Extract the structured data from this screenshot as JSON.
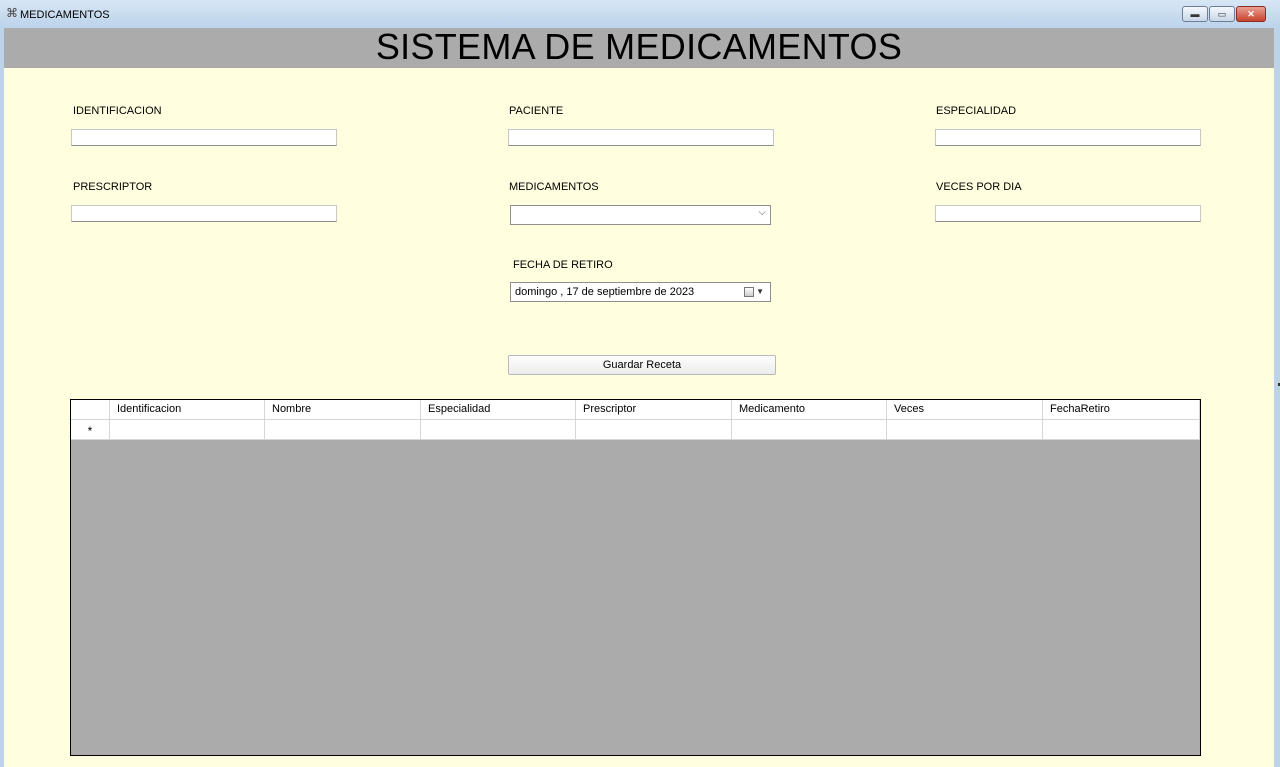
{
  "window": {
    "title": "MEDICAMENTOS"
  },
  "header": {
    "title": "SISTEMA DE MEDICAMENTOS"
  },
  "form": {
    "identificacion": {
      "label": "IDENTIFICACION",
      "value": ""
    },
    "paciente": {
      "label": "PACIENTE",
      "value": ""
    },
    "especialidad": {
      "label": "ESPECIALIDAD",
      "value": ""
    },
    "prescriptor": {
      "label": "PRESCRIPTOR",
      "value": ""
    },
    "medicamentos": {
      "label": "MEDICAMENTOS",
      "value": ""
    },
    "veces_por_dia": {
      "label": "VECES POR DIA",
      "value": ""
    },
    "fecha_retiro": {
      "label": "FECHA DE RETIRO",
      "value": "domingo ,  17 de septiembre de 2023"
    },
    "guardar_button": "Guardar Receta"
  },
  "grid": {
    "columns": [
      "Identificacion",
      "Nombre",
      "Especialidad",
      "Prescriptor",
      "Medicamento",
      "Veces",
      "FechaRetiro"
    ],
    "new_row_marker": "*"
  },
  "colors": {
    "header_bg": "#ababab",
    "client_bg": "#ffffe0",
    "grid_bg": "#ababab"
  }
}
